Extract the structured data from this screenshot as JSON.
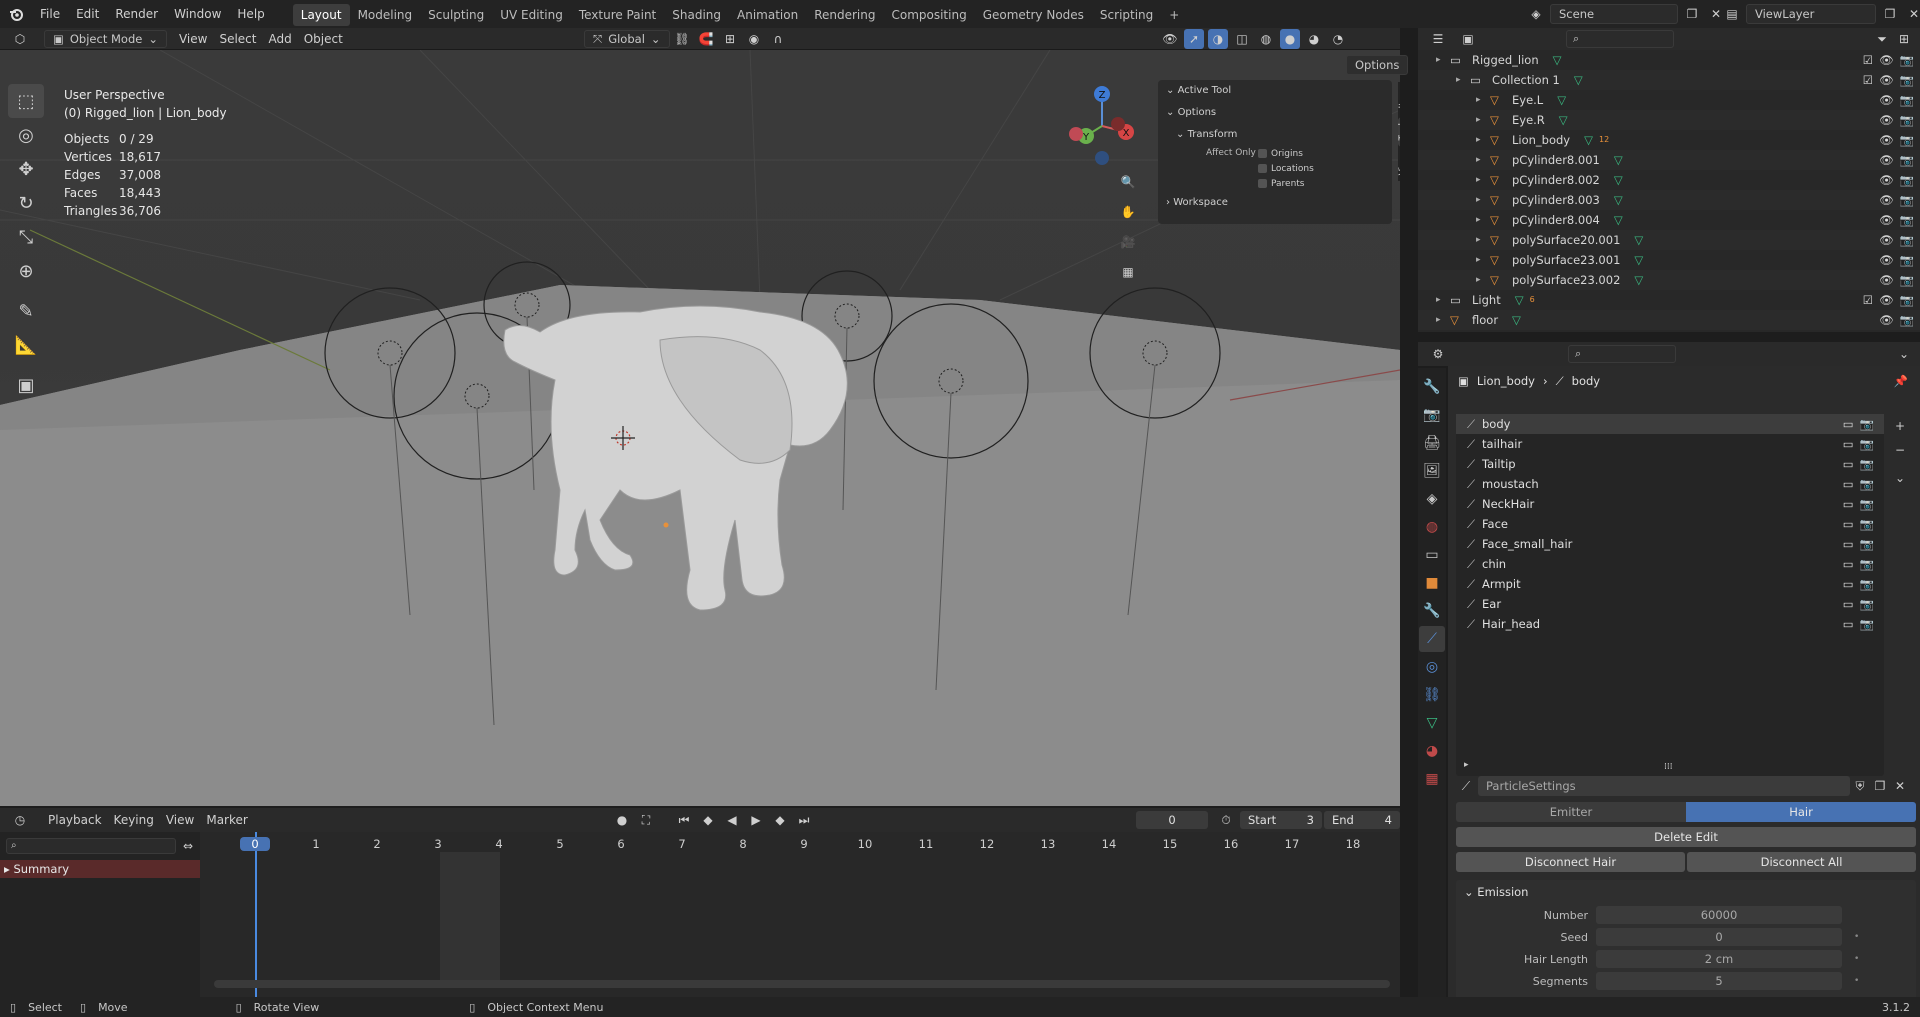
{
  "topbar": {
    "menus": [
      "File",
      "Edit",
      "Render",
      "Window",
      "Help"
    ],
    "workspaces": [
      "Layout",
      "Modeling",
      "Sculpting",
      "UV Editing",
      "Texture Paint",
      "Shading",
      "Animation",
      "Rendering",
      "Compositing",
      "Geometry Nodes",
      "Scripting"
    ],
    "active_workspace": "Layout",
    "scene": "Scene",
    "view_layer": "ViewLayer"
  },
  "viewport_header": {
    "mode": "Object Mode",
    "menus": [
      "View",
      "Select",
      "Add",
      "Object"
    ],
    "orientation": "Global",
    "options": "Options"
  },
  "viewport": {
    "perspective": "User Perspective",
    "object_info": "(0) Rigged_lion | Lion_body",
    "stats": [
      {
        "label": "Objects",
        "value": "0 / 29"
      },
      {
        "label": "Vertices",
        "value": "18,617"
      },
      {
        "label": "Edges",
        "value": "37,008"
      },
      {
        "label": "Faces",
        "value": "18,443"
      },
      {
        "label": "Triangles",
        "value": "36,706"
      }
    ],
    "gizmo": {
      "z": "Z",
      "y": "Y",
      "x": "X"
    }
  },
  "npanel": {
    "active_tool": "Active Tool",
    "options": "Options",
    "transform": "Transform",
    "affect_only": "Affect Only",
    "checks": [
      "Origins",
      "Locations",
      "Parents"
    ],
    "workspace": "Workspace",
    "tabs": [
      "Item",
      "Tool",
      "View"
    ]
  },
  "outliner": {
    "rows": [
      {
        "name": "Rigged_lion",
        "indent": 0,
        "type": "collection"
      },
      {
        "name": "Collection 1",
        "indent": 1,
        "type": "collection"
      },
      {
        "name": "Eye.L",
        "indent": 2,
        "type": "mesh"
      },
      {
        "name": "Eye.R",
        "indent": 2,
        "type": "mesh"
      },
      {
        "name": "Lion_body",
        "indent": 2,
        "type": "mesh",
        "badge": "12"
      },
      {
        "name": "pCylinder8.001",
        "indent": 2,
        "type": "mesh"
      },
      {
        "name": "pCylinder8.002",
        "indent": 2,
        "type": "mesh"
      },
      {
        "name": "pCylinder8.003",
        "indent": 2,
        "type": "mesh"
      },
      {
        "name": "pCylinder8.004",
        "indent": 2,
        "type": "mesh"
      },
      {
        "name": "polySurface20.001",
        "indent": 2,
        "type": "mesh"
      },
      {
        "name": "polySurface23.001",
        "indent": 2,
        "type": "mesh"
      },
      {
        "name": "polySurface23.002",
        "indent": 2,
        "type": "mesh"
      },
      {
        "name": "Light",
        "indent": 0,
        "type": "collection",
        "badge": "6"
      },
      {
        "name": "floor",
        "indent": 0,
        "type": "mesh"
      }
    ]
  },
  "properties": {
    "breadcrumb_object": "Lion_body",
    "breadcrumb_system": "body",
    "systems": [
      "body",
      "tailhair",
      "Tailtip",
      "moustach",
      "NeckHair",
      "Face",
      "Face_small_hair",
      "chin",
      "Armpit",
      "Ear",
      "Hair_head"
    ],
    "settings_name": "ParticleSettings",
    "type_emitter": "Emitter",
    "type_hair": "Hair",
    "delete_edit": "Delete Edit",
    "disconnect_hair": "Disconnect Hair",
    "disconnect_all": "Disconnect All",
    "emission": "Emission",
    "fields": [
      {
        "label": "Number",
        "value": "60000"
      },
      {
        "label": "Seed",
        "value": "0"
      },
      {
        "label": "Hair Length",
        "value": "2 cm"
      },
      {
        "label": "Segments",
        "value": "5"
      }
    ]
  },
  "timeline": {
    "menus": [
      "Playback",
      "Keying",
      "View",
      "Marker"
    ],
    "current_frame": "0",
    "start_label": "Start",
    "start": "3",
    "end_label": "End",
    "end": "4",
    "frames": [
      "0",
      "1",
      "2",
      "3",
      "4",
      "5",
      "6",
      "7",
      "8",
      "9",
      "10",
      "11",
      "12",
      "13",
      "14",
      "15",
      "16",
      "17",
      "18"
    ],
    "summary": "Summary"
  },
  "statusbar": {
    "select": "Select",
    "move": "Move",
    "rotate": "Rotate View",
    "context": "Object Context Menu",
    "version": "3.1.2"
  }
}
